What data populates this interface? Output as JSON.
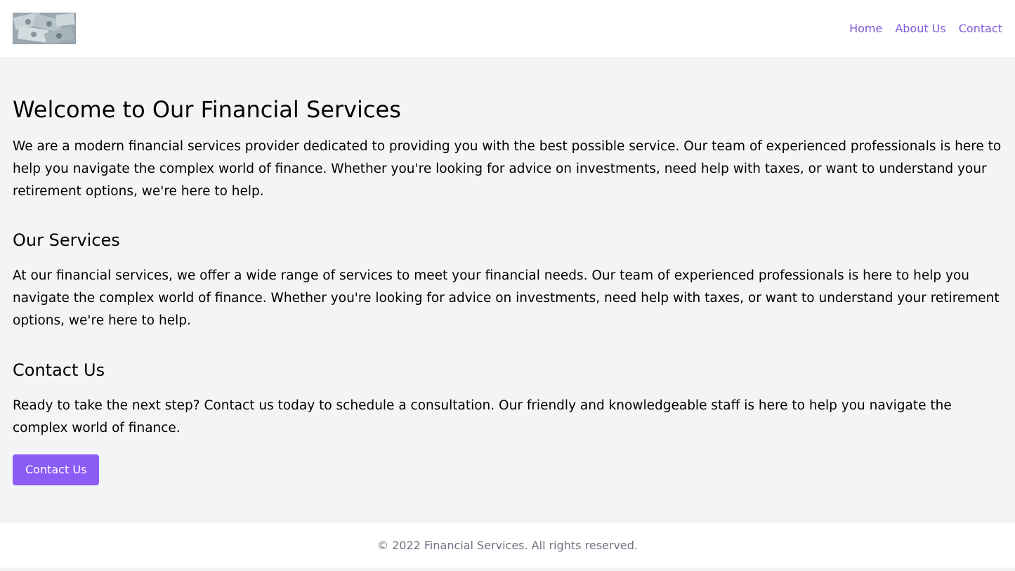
{
  "header": {
    "logo_alt": "Financial Services logo",
    "nav": [
      {
        "label": "Home"
      },
      {
        "label": "About Us"
      },
      {
        "label": "Contact"
      }
    ]
  },
  "welcome": {
    "title": "Welcome to Our Financial Services",
    "text": "We are a modern financial services provider dedicated to providing you with the best possible service. Our team of experienced professionals is here to help you navigate the complex world of finance. Whether you're looking for advice on investments, need help with taxes, or want to understand your retirement options, we're here to help."
  },
  "services": {
    "title": "Our Services",
    "text": "At our financial services, we offer a wide range of services to meet your financial needs. Our team of experienced professionals is here to help you navigate the complex world of finance. Whether you're looking for advice on investments, need help with taxes, or want to understand your retirement options, we're here to help."
  },
  "contact": {
    "title": "Contact Us",
    "text": "Ready to take the next step? Contact us today to schedule a consultation. Our friendly and knowledgeable staff is here to help you navigate the complex world of finance.",
    "button_label": "Contact Us"
  },
  "footer": {
    "text": "© 2022 Financial Services. All rights reserved."
  },
  "colors": {
    "accent": "#805ad5",
    "button": "#8b5cf6",
    "page_bg": "#f3f4f6",
    "footer_text": "#6b7280"
  }
}
